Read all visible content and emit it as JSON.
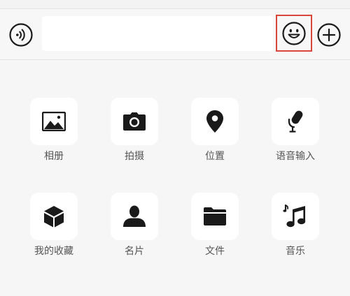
{
  "input_bar": {
    "text_value": "",
    "voice_icon": "voice-input-icon",
    "emoji_icon": "smiley-face-icon",
    "plus_icon": "plus-circle-icon"
  },
  "more_panel": {
    "items": [
      {
        "label": "相册",
        "icon": "image-icon"
      },
      {
        "label": "拍摄",
        "icon": "camera-icon"
      },
      {
        "label": "位置",
        "icon": "location-pin-icon"
      },
      {
        "label": "语音输入",
        "icon": "microphone-icon"
      },
      {
        "label": "我的收藏",
        "icon": "cube-icon"
      },
      {
        "label": "名片",
        "icon": "person-icon"
      },
      {
        "label": "文件",
        "icon": "folder-icon"
      },
      {
        "label": "音乐",
        "icon": "music-note-icon"
      }
    ]
  },
  "colors": {
    "background": "#f6f6f6",
    "tile_background": "#ffffff",
    "icon": "#1a1a1a",
    "label": "#555555",
    "highlight_border": "#d9463b"
  }
}
